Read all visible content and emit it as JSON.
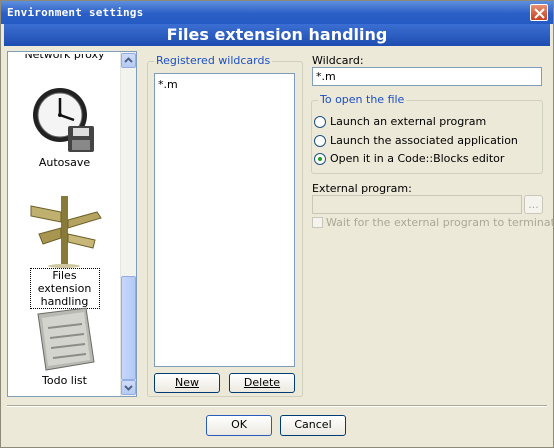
{
  "window": {
    "title": "Environment settings"
  },
  "header": {
    "title": "Files extension handling"
  },
  "sidebar": {
    "items": [
      {
        "label": "Network proxy",
        "icon": "network-proxy-icon"
      },
      {
        "label": "Autosave",
        "icon": "clock-floppy-icon"
      },
      {
        "label": "Files extension handling",
        "icon": "signpost-icon",
        "selected": true
      },
      {
        "label": "Todo list",
        "icon": "notepad-icon"
      }
    ]
  },
  "wildcards": {
    "group_title": "Registered wildcards",
    "items": [
      "*.m"
    ],
    "new_label": "New",
    "delete_label": "Delete"
  },
  "settings": {
    "wildcard_label": "Wildcard:",
    "wildcard_value": "*.m",
    "open_group_title": "To open the file",
    "options": [
      {
        "label": "Launch an external program",
        "checked": false
      },
      {
        "label": "Launch the associated application",
        "checked": false
      },
      {
        "label": "Open it in a Code::Blocks editor",
        "checked": true
      }
    ],
    "external_program_label": "External program:",
    "external_program_value": "",
    "browse_label": "...",
    "wait_label": "Wait for the external program to terminate"
  },
  "footer": {
    "ok_label": "OK",
    "cancel_label": "Cancel"
  }
}
